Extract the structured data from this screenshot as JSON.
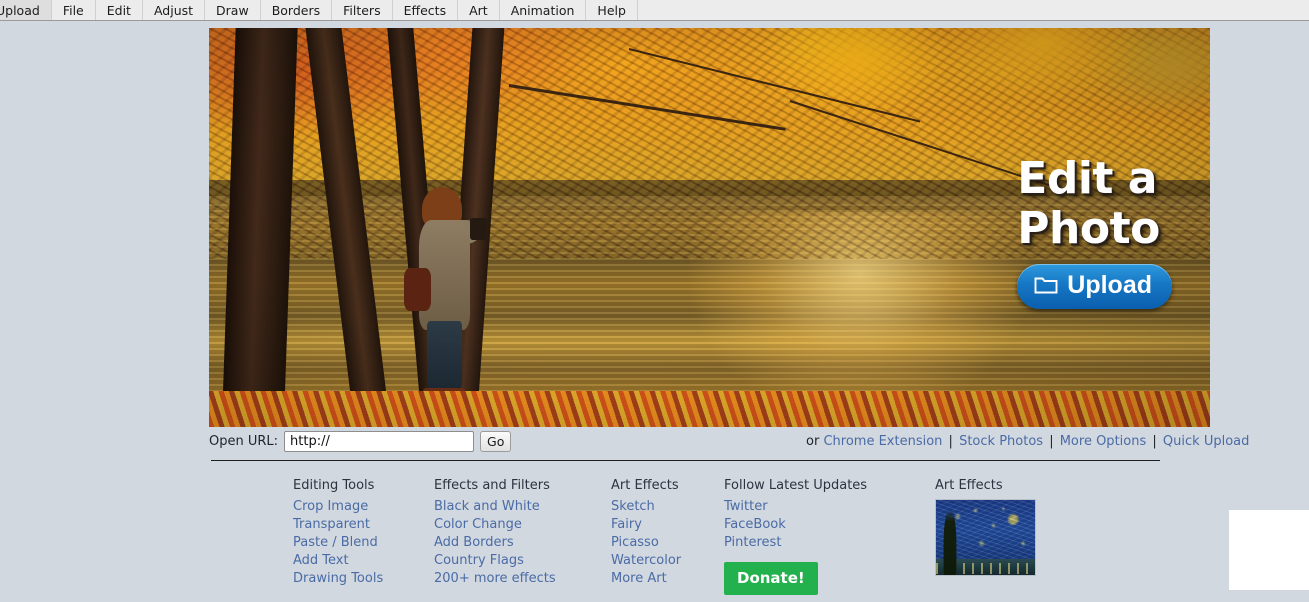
{
  "menubar": {
    "items": [
      {
        "label": "Upload",
        "name": "menu-upload"
      },
      {
        "label": "File",
        "name": "menu-file"
      },
      {
        "label": "Edit",
        "name": "menu-edit"
      },
      {
        "label": "Adjust",
        "name": "menu-adjust"
      },
      {
        "label": "Draw",
        "name": "menu-draw"
      },
      {
        "label": "Borders",
        "name": "menu-borders"
      },
      {
        "label": "Filters",
        "name": "menu-filters"
      },
      {
        "label": "Effects",
        "name": "menu-effects"
      },
      {
        "label": "Art",
        "name": "menu-art"
      },
      {
        "label": "Animation",
        "name": "menu-animation"
      },
      {
        "label": "Help",
        "name": "menu-help"
      }
    ]
  },
  "hero": {
    "headline_line1": "Edit a",
    "headline_line2": "Photo",
    "upload_button_label": "Upload",
    "upload_icon": "folder-icon"
  },
  "url_bar": {
    "label": "Open URL:",
    "value": "http://",
    "placeholder": "http://",
    "go_label": "Go",
    "prefix_text": "or",
    "links": [
      {
        "label": "Chrome Extension",
        "name": "link-chrome-extension"
      },
      {
        "label": "Stock Photos",
        "name": "link-stock-photos"
      },
      {
        "label": "More Options",
        "name": "link-more-options"
      },
      {
        "label": "Quick Upload",
        "name": "link-quick-upload"
      }
    ],
    "separator": "|"
  },
  "columns": [
    {
      "heading": "Editing Tools",
      "links": [
        "Crop Image",
        "Transparent",
        "Paste / Blend",
        "Add Text",
        "Drawing Tools"
      ]
    },
    {
      "heading": "Effects and Filters",
      "links": [
        "Black and White",
        "Color Change",
        "Add Borders",
        "Country Flags",
        "200+ more effects"
      ]
    },
    {
      "heading": "Art Effects",
      "links": [
        "Sketch",
        "Fairy",
        "Picasso",
        "Watercolor",
        "More Art"
      ]
    },
    {
      "heading": "Follow Latest Updates",
      "links": [
        "Twitter",
        "FaceBook",
        "Pinterest"
      ],
      "donate_label": "Donate!"
    }
  ],
  "art_promo": {
    "label": "Art Effects",
    "thumbnail_name": "starry-night-thumbnail"
  },
  "colors": {
    "page_background": "#d2d8df",
    "menubar_background": "#ececec",
    "link": "#4a6ba6",
    "heading": "#2c3340",
    "upload_button": "#1779c6",
    "donate_button": "#22b14c",
    "divider": "#1e1e1e"
  }
}
